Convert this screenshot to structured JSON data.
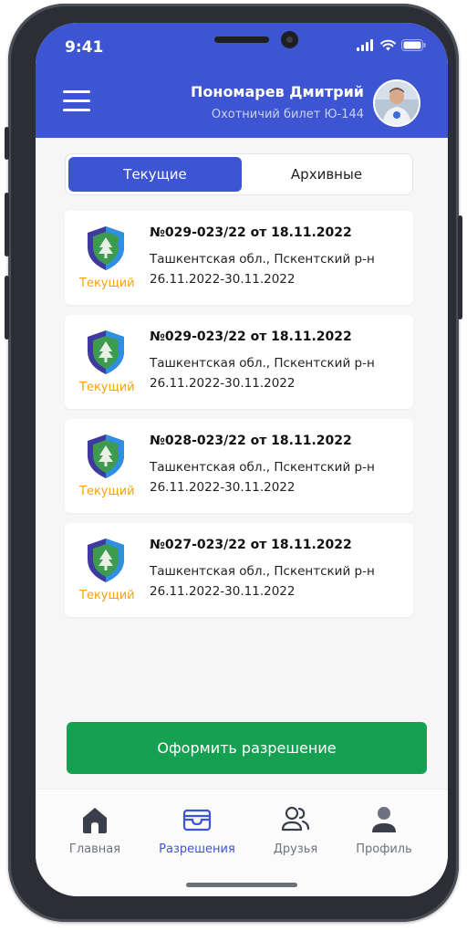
{
  "status_bar": {
    "time": "9:41"
  },
  "header": {
    "user_name": "Пономарев Дмитрий",
    "ticket": "Охотничий билет Ю-144"
  },
  "tabs": [
    {
      "label": "Текущие",
      "active": true
    },
    {
      "label": "Архивные",
      "active": false
    }
  ],
  "permits": [
    {
      "status": "Текущий",
      "number": "№029-023/22 от 18.11.2022",
      "place": "Ташкентская обл., Пскентский р-н",
      "dates": "26.11.2022-30.11.2022"
    },
    {
      "status": "Текущий",
      "number": "№029-023/22 от 18.11.2022",
      "place": "Ташкентская обл., Пскентский р-н",
      "dates": "26.11.2022-30.11.2022"
    },
    {
      "status": "Текущий",
      "number": "№028-023/22 от 18.11.2022",
      "place": "Ташкентская обл., Пскентский р-н",
      "dates": "26.11.2022-30.11.2022"
    },
    {
      "status": "Текущий",
      "number": "№027-023/22 от 18.11.2022",
      "place": "Ташкентская обл., Пскентский р-н",
      "dates": "26.11.2022-30.11.2022"
    }
  ],
  "action_button": "Оформить разрешение",
  "bottom_nav": [
    {
      "label": "Главная",
      "icon": "home-icon",
      "active": false
    },
    {
      "label": "Разрешения",
      "icon": "wallet-icon",
      "active": true
    },
    {
      "label": "Друзья",
      "icon": "friends-icon",
      "active": false
    },
    {
      "label": "Профиль",
      "icon": "profile-icon",
      "active": false
    }
  ],
  "colors": {
    "accent": "#3d55d3",
    "action": "#16a152",
    "status": "#f2a30f",
    "nav_inactive": "#6c7280"
  }
}
